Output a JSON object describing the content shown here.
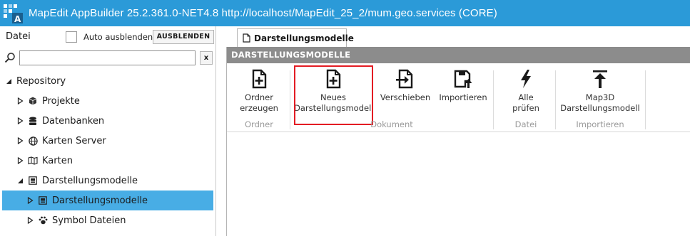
{
  "window": {
    "title": "MapEdit AppBuilder 25.2.361.0-NET4.8 http://localhost/MapEdit_25_2/mum.geo.services (CORE)",
    "colors": {
      "titlebar": "#2b9ad8",
      "selection": "#48ade5",
      "header": "#8c8c8c",
      "highlight": "#e31b23"
    }
  },
  "left_pane": {
    "datei_label": "Datei",
    "auto_hide_label": "Auto ausblenden",
    "hide_button": "AUSBLENDEN",
    "search_placeholder": "",
    "clear_button": "x",
    "tree": [
      {
        "label": "Repository",
        "icon": "none",
        "expanded": true
      },
      {
        "label": "Projekte",
        "icon": "cube-icon",
        "expanded": false
      },
      {
        "label": "Datenbanken",
        "icon": "database-icon",
        "expanded": false
      },
      {
        "label": "Karten Server",
        "icon": "globe-icon",
        "expanded": false
      },
      {
        "label": "Karten",
        "icon": "map-icon",
        "expanded": false
      },
      {
        "label": "Darstellungsmodelle",
        "icon": "style-model-icon",
        "expanded": true
      },
      {
        "label": "Darstellungsmodelle",
        "icon": "style-model-icon",
        "expanded": false,
        "selected": true
      },
      {
        "label": "Symbol Dateien",
        "icon": "paw-icon",
        "expanded": false
      }
    ]
  },
  "tab": {
    "label": "Darstellungsmodelle"
  },
  "content": {
    "header": "DARSTELLUNGSMODELLE",
    "ribbon": {
      "groups": [
        {
          "label": "Ordner"
        },
        {
          "label": "Dokument"
        },
        {
          "label": "Datei"
        },
        {
          "label": "Importieren"
        }
      ],
      "buttons": {
        "ordner_erzeugen": [
          "Ordner",
          "erzeugen"
        ],
        "neues": [
          "Neues",
          "Darstellungsmodell"
        ],
        "verschieben": "Verschieben",
        "importieren": "Importieren",
        "alle_pruefen": [
          "Alle",
          "prüfen"
        ],
        "map3d": [
          "Map3D",
          "Darstellungsmodell"
        ]
      }
    }
  }
}
